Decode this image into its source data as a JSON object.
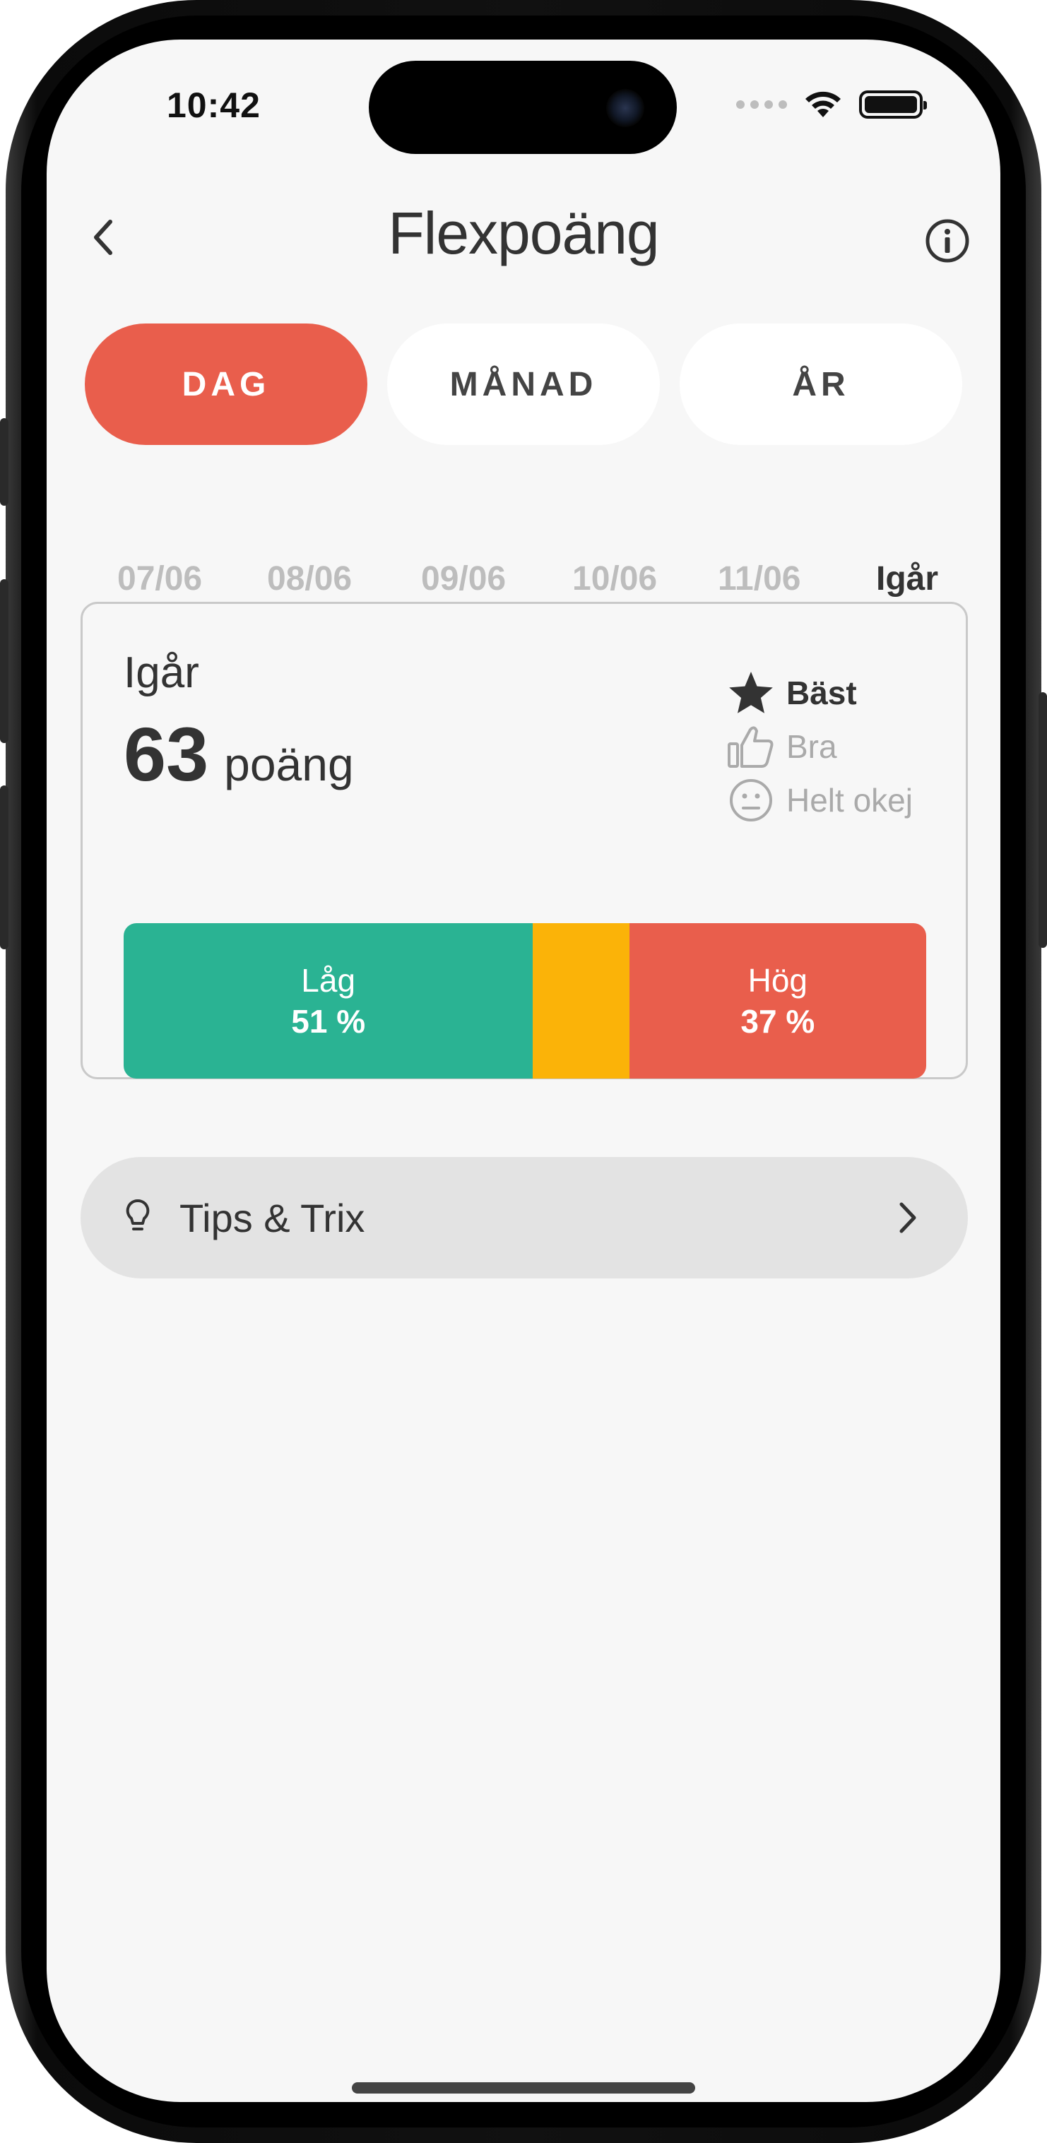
{
  "status_bar": {
    "time": "10:42"
  },
  "header": {
    "title": "Flexpoäng",
    "back_icon": "chevron-left-icon",
    "info_icon": "info-circle-icon"
  },
  "tabs": [
    {
      "label": "DAG",
      "active": true
    },
    {
      "label": "MÅNAD",
      "active": false
    },
    {
      "label": "ÅR",
      "active": false
    }
  ],
  "dates": [
    {
      "label": "07/06",
      "active": false
    },
    {
      "label": "08/06",
      "active": false
    },
    {
      "label": "09/06",
      "active": false
    },
    {
      "label": "10/06",
      "active": false
    },
    {
      "label": "11/06",
      "active": false
    },
    {
      "label": "Igår",
      "active": true
    }
  ],
  "score_card": {
    "day_label": "Igår",
    "score": "63",
    "unit": "poäng",
    "legend": [
      {
        "icon": "star-icon",
        "label": "Bäst",
        "active": true
      },
      {
        "icon": "thumbs-up-icon",
        "label": "Bra",
        "active": false
      },
      {
        "icon": "neutral-face-icon",
        "label": "Helt okej",
        "active": false
      }
    ],
    "distribution": [
      {
        "name": "Låg",
        "percent_label": "51 %",
        "percent": 51,
        "color": "#2ab393"
      },
      {
        "name": "",
        "percent_label": "",
        "percent": 12,
        "color": "#fbb308"
      },
      {
        "name": "Hög",
        "percent_label": "37 %",
        "percent": 37,
        "color": "#e95e4c"
      }
    ]
  },
  "tips": {
    "label": "Tips & Trix",
    "icon": "lightbulb-icon",
    "chevron": "chevron-right-icon"
  },
  "colors": {
    "accent": "#e95e4c",
    "low": "#2ab393",
    "mid": "#fbb308",
    "high": "#e95e4c",
    "background": "#f7f7f7"
  }
}
